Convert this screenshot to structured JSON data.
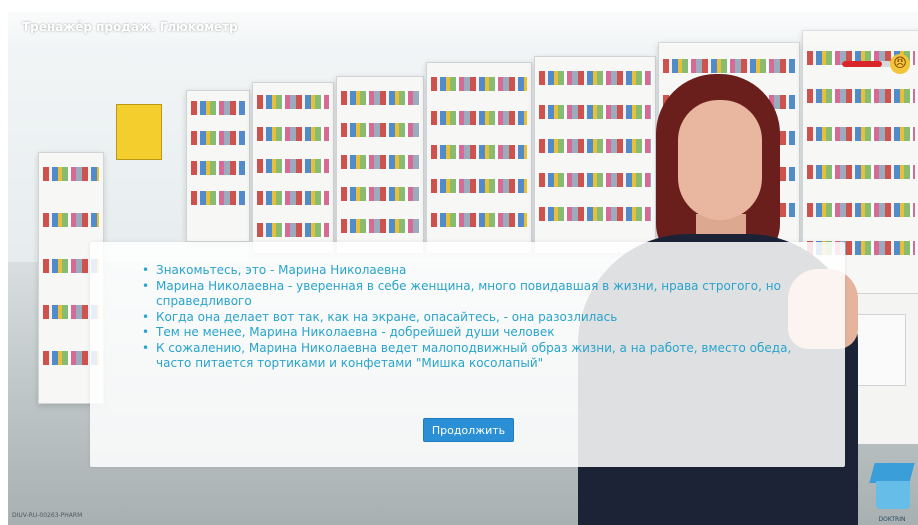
{
  "header": {
    "title": "Тренажёр продаж. Глюкометр"
  },
  "mood": {
    "level": 0.8,
    "fill_color": "#d9262b",
    "icon": "angry-face-icon",
    "glyph": "😠"
  },
  "dialog": {
    "bullets": [
      "Знакомьтесь, это - Марина Николаевна",
      "Марина Николаевна - уверенная в себе женщина, много повидавшая в жизни, нрава строгого, но справедливого",
      "Когда она делает вот так, как на экране, опасайтесь, - она разозлилась",
      "Тем не менее, Марина Николаевна - добрейшей души человек",
      "К сожалению, Марина Николаевна ведет малоподвижный образ жизни, а на работе, вместо обеда, часто питается тортиками и конфетами \"Мишка косолапый\""
    ],
    "continue_label": "Продолжить",
    "text_color": "#28a4cc",
    "button_color": "#2b8fd6"
  },
  "footer": {
    "code": "DIUV-RU-00263-PHARM",
    "logo_text": "DOKTRIN"
  }
}
